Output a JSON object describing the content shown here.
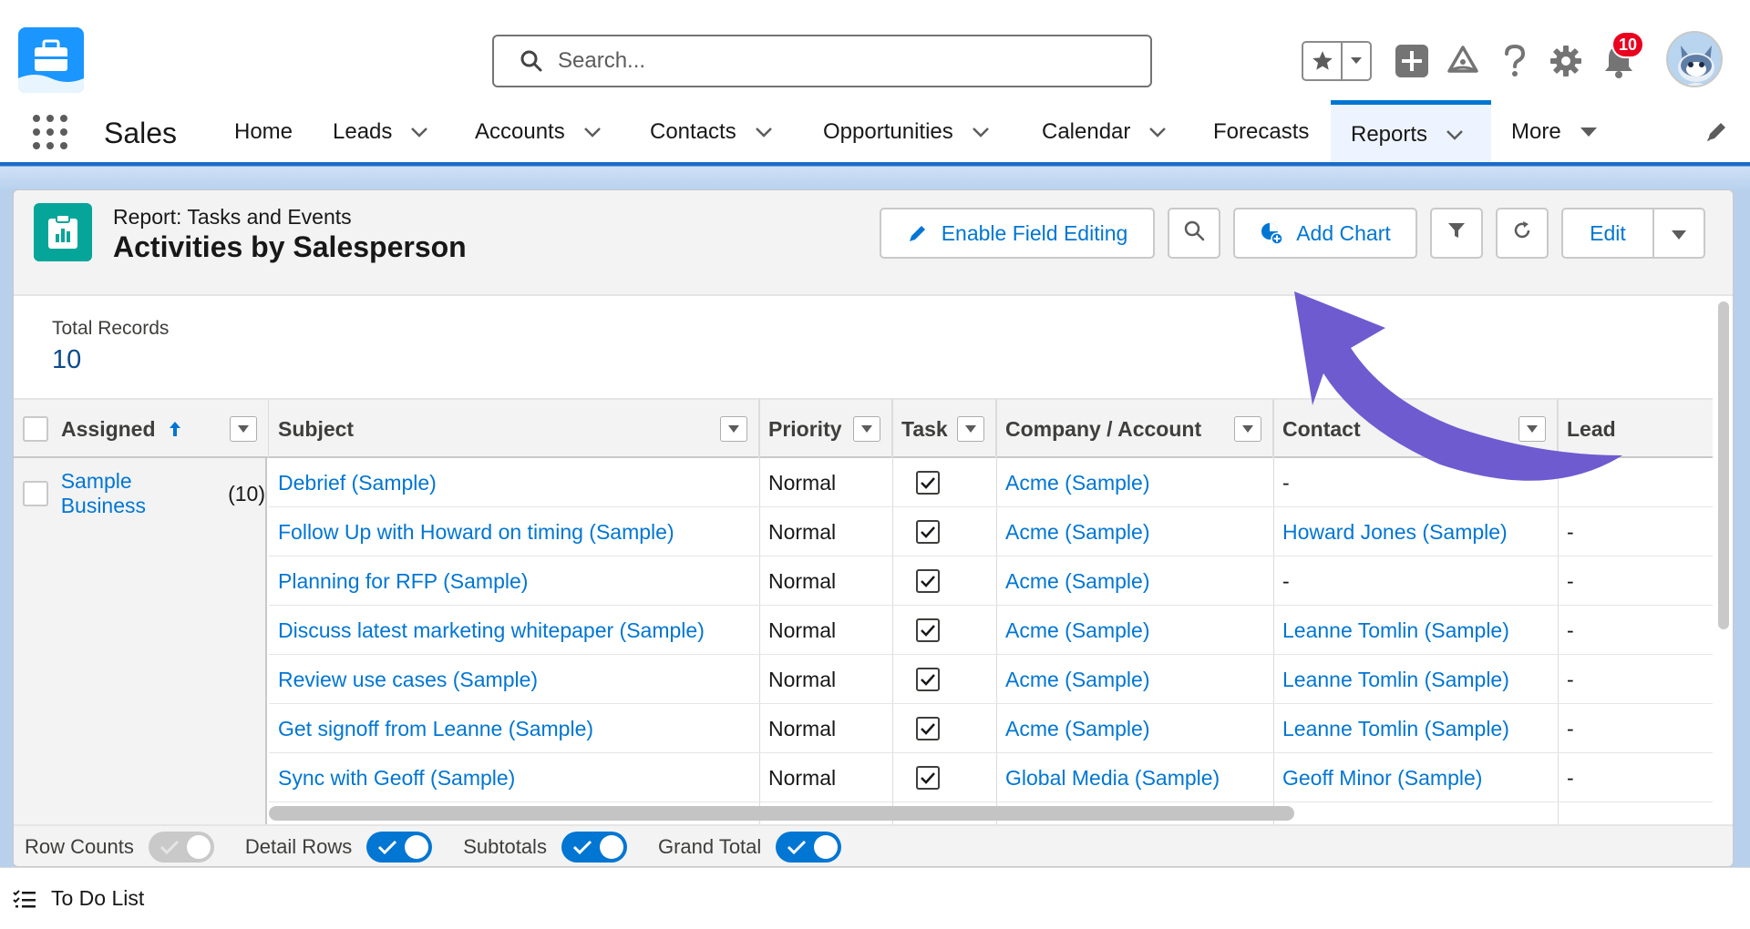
{
  "header": {
    "search_placeholder": "Search...",
    "notification_count": "10"
  },
  "nav": {
    "app_name": "Sales",
    "items": [
      {
        "label": "Home"
      },
      {
        "label": "Leads"
      },
      {
        "label": "Accounts"
      },
      {
        "label": "Contacts"
      },
      {
        "label": "Opportunities"
      },
      {
        "label": "Calendar"
      },
      {
        "label": "Forecasts"
      },
      {
        "label": "Reports"
      },
      {
        "label": "More"
      }
    ],
    "active": "Reports"
  },
  "report": {
    "subtitle": "Report: Tasks and Events",
    "title": "Activities by Salesperson",
    "buttons": {
      "enable_field_editing": "Enable Field Editing",
      "add_chart": "Add Chart",
      "edit": "Edit"
    },
    "total_records_label": "Total Records",
    "total_records_value": "10"
  },
  "table": {
    "columns": [
      "Assigned",
      "Subject",
      "Priority",
      "Task",
      "Company / Account",
      "Contact",
      "Lead"
    ],
    "group": {
      "label": "Sample Business",
      "count": "(10)"
    },
    "rows": [
      {
        "subject": "Debrief (Sample)",
        "priority": "Normal",
        "task": true,
        "account": "Acme (Sample)",
        "contact": "-",
        "lead": ""
      },
      {
        "subject": "Follow Up with Howard on timing (Sample)",
        "priority": "Normal",
        "task": true,
        "account": "Acme (Sample)",
        "contact": "Howard Jones (Sample)",
        "lead": "-"
      },
      {
        "subject": "Planning for RFP (Sample)",
        "priority": "Normal",
        "task": true,
        "account": "Acme (Sample)",
        "contact": "-",
        "lead": "-"
      },
      {
        "subject": "Discuss latest marketing whitepaper (Sample)",
        "priority": "Normal",
        "task": true,
        "account": "Acme (Sample)",
        "contact": "Leanne Tomlin (Sample)",
        "lead": "-"
      },
      {
        "subject": "Review use cases (Sample)",
        "priority": "Normal",
        "task": true,
        "account": "Acme (Sample)",
        "contact": "Leanne Tomlin (Sample)",
        "lead": "-"
      },
      {
        "subject": "Get signoff from Leanne (Sample)",
        "priority": "Normal",
        "task": true,
        "account": "Acme (Sample)",
        "contact": "Leanne Tomlin (Sample)",
        "lead": "-"
      },
      {
        "subject": "Sync with Geoff (Sample)",
        "priority": "Normal",
        "task": true,
        "account": "Global Media (Sample)",
        "contact": "Geoff Minor (Sample)",
        "lead": "-"
      }
    ]
  },
  "footer": {
    "row_counts": "Row Counts",
    "detail_rows": "Detail Rows",
    "subtotals": "Subtotals",
    "grand_total": "Grand Total"
  },
  "utility": {
    "todo_label": "To Do List"
  },
  "colors": {
    "brand_blue": "#0176d3",
    "report_icon": "#06a59a",
    "annotation_arrow": "#6e5bd0",
    "badge_red": "#ea001e"
  }
}
